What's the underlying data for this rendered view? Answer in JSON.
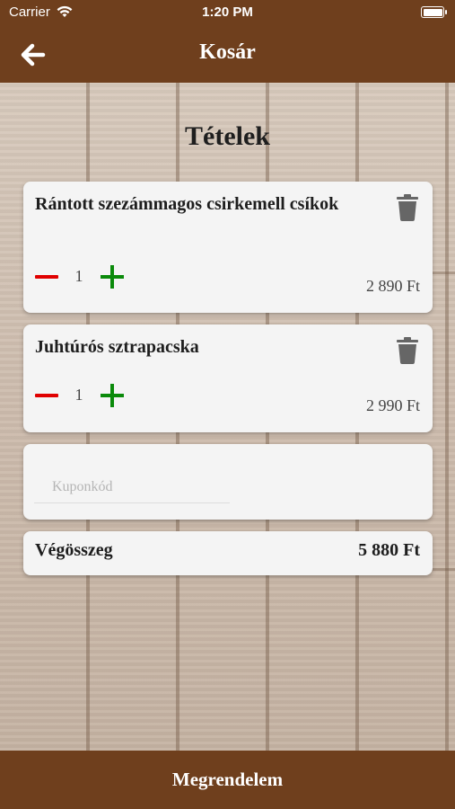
{
  "status_bar": {
    "carrier": "Carrier",
    "time": "1:20 PM"
  },
  "header": {
    "title": "Kosár",
    "back_icon": "arrow-left-icon"
  },
  "main": {
    "heading": "Tételek",
    "items": [
      {
        "name": "Rántott szezámmagos csirkemell csíkok",
        "quantity": "1",
        "price": "2 890 Ft"
      },
      {
        "name": "Juhtúrós sztrapacska",
        "quantity": "1",
        "price": "2 990 Ft"
      }
    ],
    "coupon": {
      "placeholder": "Kuponkód",
      "value": ""
    },
    "total": {
      "label": "Végösszeg",
      "value": "5 880 Ft"
    }
  },
  "footer": {
    "order_button": "Megrendelem"
  },
  "colors": {
    "brand_brown": "#6f3f1d",
    "minus_red": "#e00000",
    "plus_green": "#0a8a0a",
    "card_bg": "#f4f4f4"
  }
}
